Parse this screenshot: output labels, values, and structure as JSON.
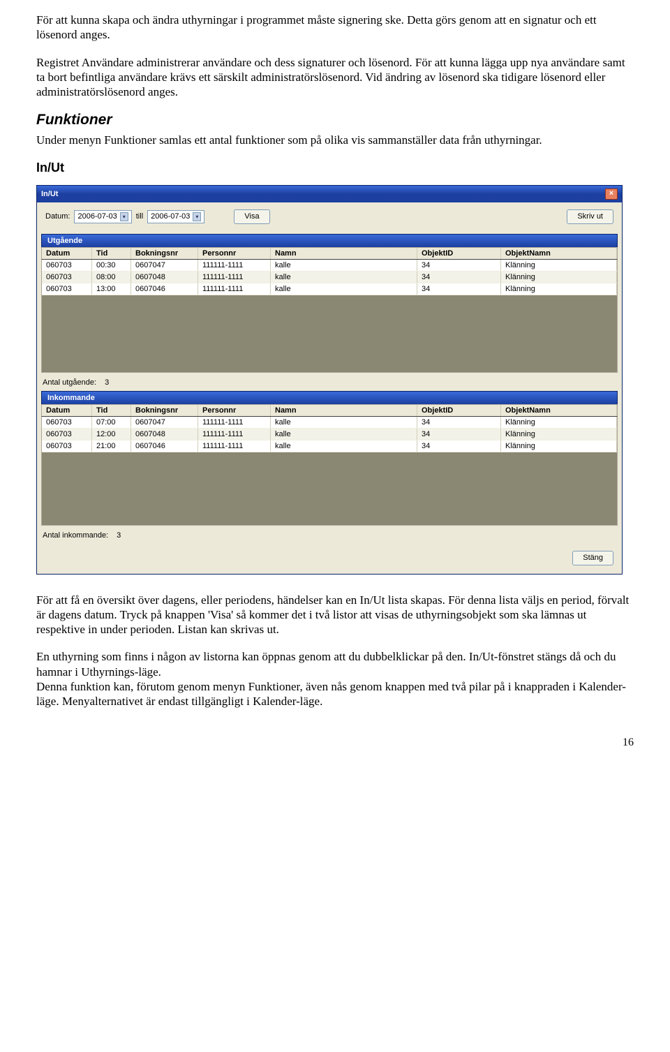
{
  "para1": "För att kunna skapa och ändra uthyrningar i programmet måste signering ske. Detta görs genom att en signatur och ett lösenord anges.",
  "para2": "Registret Användare administrerar användare och dess signaturer och lösenord. För att kunna lägga upp nya användare samt ta bort befintliga användare krävs ett särskilt administratörslösenord. Vid ändring av lösenord ska tidigare lösenord eller administratörslösenord anges.",
  "heading_funktioner": "Funktioner",
  "para_funktioner": "Under menyn Funktioner samlas ett antal funktioner som på olika vis sammanställer data från uthyrningar.",
  "heading_inut": "In/Ut",
  "window": {
    "title": "In/Ut",
    "toolbar": {
      "datum_label": "Datum:",
      "date_from": "2006-07-03",
      "till_label": "till",
      "date_to": "2006-07-03",
      "visa": "Visa",
      "skrivut": "Skriv ut"
    },
    "columns": {
      "datum": "Datum",
      "tid": "Tid",
      "bokningsnr": "Bokningsnr",
      "personnr": "Personnr",
      "namn": "Namn",
      "objektid": "ObjektID",
      "objektnamn": "ObjektNamn"
    },
    "utg": {
      "title": "Utgående",
      "rows": [
        {
          "datum": "060703",
          "tid": "00:30",
          "bok": "0607047",
          "pers": "111111-1111",
          "namn": "kalle",
          "obj": "34",
          "onm": "Klänning"
        },
        {
          "datum": "060703",
          "tid": "08:00",
          "bok": "0607048",
          "pers": "111111-1111",
          "namn": "kalle",
          "obj": "34",
          "onm": "Klänning"
        },
        {
          "datum": "060703",
          "tid": "13:00",
          "bok": "0607046",
          "pers": "111111-1111",
          "namn": "kalle",
          "obj": "34",
          "onm": "Klänning"
        }
      ],
      "count_label": "Antal utgående:",
      "count": "3"
    },
    "ink": {
      "title": "Inkommande",
      "rows": [
        {
          "datum": "060703",
          "tid": "07:00",
          "bok": "0607047",
          "pers": "111111-1111",
          "namn": "kalle",
          "obj": "34",
          "onm": "Klänning"
        },
        {
          "datum": "060703",
          "tid": "12:00",
          "bok": "0607048",
          "pers": "111111-1111",
          "namn": "kalle",
          "obj": "34",
          "onm": "Klänning"
        },
        {
          "datum": "060703",
          "tid": "21:00",
          "bok": "0607046",
          "pers": "111111-1111",
          "namn": "kalle",
          "obj": "34",
          "onm": "Klänning"
        }
      ],
      "count_label": "Antal inkommande:",
      "count": "3"
    },
    "close_button": "Stäng"
  },
  "para3": "För att få en översikt över dagens, eller periodens, händelser kan en In/Ut lista skapas. För denna lista väljs en period, förvalt är dagens datum. Tryck på knappen 'Visa' så kommer det i två listor att visas de uthyrningsobjekt som ska lämnas ut respektive in under perioden. Listan kan skrivas ut.",
  "para4": "En uthyrning som finns i någon av listorna kan öppnas genom att du dubbelklickar på den. In/Ut-fönstret stängs då och du hamnar i Uthyrnings-läge.",
  "para5": "Denna funktion kan, förutom genom menyn Funktioner, även nås genom knappen med två pilar på i knappraden i Kalender-läge. Menyalternativet är endast tillgängligt i Kalender-läge.",
  "page_number": "16"
}
